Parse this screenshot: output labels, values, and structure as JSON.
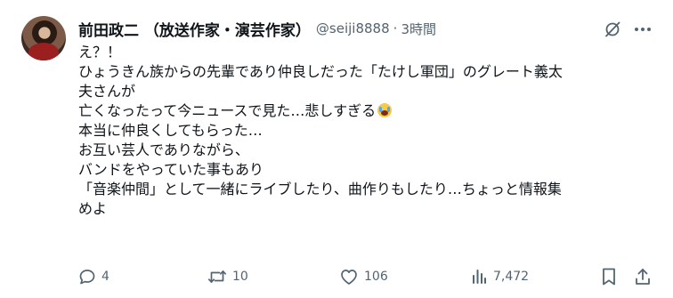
{
  "author": {
    "name": "前田政二 （放送作家・演芸作家）",
    "handle": "@seiji8888",
    "separator": "·",
    "time": "3時間"
  },
  "post": {
    "lines": [
      "え？！",
      "ひょうきん族からの先輩であり仲良しだった「たけし軍団」のグレート義太",
      "夫さんが",
      "亡くなったって今ニュースで見た…悲しすぎる",
      "本当に仲良くしてもらった…",
      "お互い芸人でありながら、",
      "バンドをやっていた事もあり",
      "「音楽仲間」として一緒にライブしたり、曲作りもしたり…ちょっと情報集",
      "めよ"
    ],
    "emoji": "loudly-crying-face"
  },
  "actions": {
    "reply_count": "4",
    "repost_count": "10",
    "like_count": "106",
    "view_count": "7,472"
  },
  "icons": {
    "grok": "grok-icon",
    "more": "more-icon",
    "reply": "reply-icon",
    "repost": "repost-icon",
    "like": "like-icon",
    "views": "views-icon",
    "bookmark": "bookmark-icon",
    "share": "share-icon"
  },
  "colors": {
    "text": "#0f1419",
    "secondary": "#536471",
    "background": "#ffffff"
  }
}
